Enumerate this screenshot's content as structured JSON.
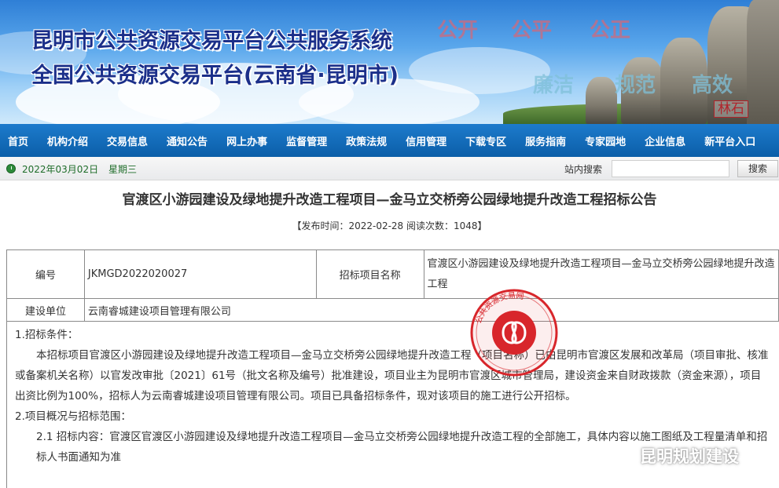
{
  "header": {
    "title_line1": "昆明市公共资源交易平台公共服务系统",
    "title_line2": "全国公共资源交易平台(云南省·昆明市)",
    "slogans_top": [
      "公开",
      "公平",
      "公正"
    ],
    "slogans_bottom": [
      "廉洁",
      "规范",
      "高效"
    ],
    "stone_mark": "林石"
  },
  "nav": {
    "items": [
      "首页",
      "机构介绍",
      "交易信息",
      "通知公告",
      "网上办事",
      "监督管理",
      "政策法规",
      "信用管理",
      "下载专区",
      "服务指南",
      "专家园地",
      "企业信息",
      "新平台入口"
    ]
  },
  "subbar": {
    "date": "2022年03月02日",
    "weekday": "星期三",
    "search_label": "站内搜索",
    "search_value": "",
    "search_button": "搜索"
  },
  "article": {
    "title": "官渡区小游园建设及绿地提升改造工程项目—金马立交桥旁公园绿地提升改造工程招标公告",
    "publish_info": "【发布时间：2022-02-28 阅读次数：1048】",
    "table": {
      "code_label": "编号",
      "code_value": "JKMGD2022020027",
      "project_label": "招标项目名称",
      "project_value": "官渡区小游园建设及绿地提升改造工程项目—金马立交桥旁公园绿地提升改造工程",
      "unit_label": "建设单位",
      "unit_value": "云南睿城建设项目管理有限公司"
    },
    "section1_heading": "1.招标条件：",
    "section1_body": "本招标项目官渡区小游园建设及绿地提升改造工程项目—金马立交桥旁公园绿地提升改造工程（项目名称）已由昆明市官渡区发展和改革局（项目审批、核准或备案机关名称）以官发改审批〔2021〕61号（批文名称及编号）批准建设，项目业主为昆明市官渡区城市管理局，建设资金来自财政拨款（资金来源），项目出资比例为100%，招标人为云南睿城建设项目管理有限公司。项目已具备招标条件，现对该项目的施工进行公开招标。",
    "section2_heading": "2.项目概况与招标范围：",
    "section2_body": "2.1 招标内容：官渡区官渡区小游园建设及绿地提升改造工程项目—金马立交桥旁公园绿地提升改造工程的全部施工，具体内容以施工图纸及工程量清单和招标人书面通知为准"
  },
  "stamp": {
    "ring_text": "公共资源交易网",
    "color": "#d8262b"
  },
  "watermark": {
    "text": "昆明规划建设"
  }
}
